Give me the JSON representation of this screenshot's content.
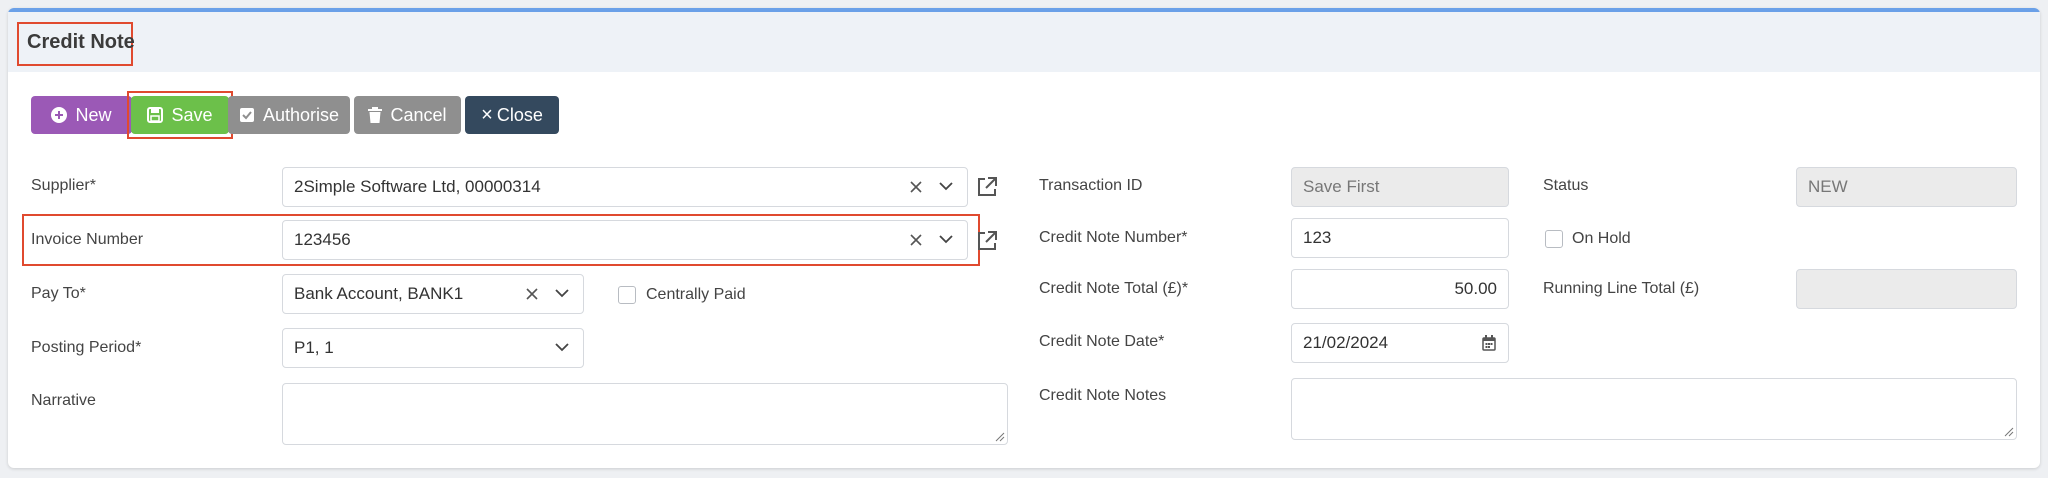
{
  "header": {
    "title": "Credit Note"
  },
  "toolbar": {
    "new_label": "New",
    "save_label": "Save",
    "authorise_label": "Authorise",
    "cancel_label": "Cancel",
    "close_label": "Close",
    "close_glyph": "×"
  },
  "form": {
    "supplier": {
      "label": "Supplier*",
      "value": "2Simple Software Ltd, 00000314"
    },
    "invoice_number": {
      "label": "Invoice Number",
      "value": "123456"
    },
    "pay_to": {
      "label": "Pay To*",
      "value": "Bank Account, BANK1"
    },
    "centrally_paid": {
      "label": "Centrally Paid",
      "checked": false
    },
    "posting_period": {
      "label": "Posting Period*",
      "value": "P1, 1"
    },
    "narrative": {
      "label": "Narrative",
      "value": ""
    },
    "transaction_id": {
      "label": "Transaction ID",
      "value": "Save First"
    },
    "status": {
      "label": "Status",
      "value": "NEW"
    },
    "credit_note_number": {
      "label": "Credit Note Number*",
      "value": "123"
    },
    "on_hold": {
      "label": "On Hold",
      "checked": false
    },
    "credit_note_total": {
      "label": "Credit Note Total (£)*",
      "value": "50.00"
    },
    "running_line_total": {
      "label": "Running Line Total (£)",
      "value": ""
    },
    "credit_note_date": {
      "label": "Credit Note Date*",
      "value": "21/02/2024"
    },
    "credit_note_notes": {
      "label": "Credit Note Notes",
      "value": ""
    }
  },
  "colors": {
    "new": "#9b59b6",
    "save": "#6cc04a",
    "authorise": "#8f8f8f",
    "cancel": "#8f8f8f",
    "close": "#34495e",
    "highlight": "#e04a2f",
    "accent": "#6aa0e8"
  },
  "icons": [
    "plus-circle-icon",
    "save-icon",
    "check-square-icon",
    "trash-icon",
    "close-icon",
    "clear-icon",
    "chevron-down-icon",
    "external-link-icon",
    "calendar-icon",
    "resize-handle-icon"
  ]
}
